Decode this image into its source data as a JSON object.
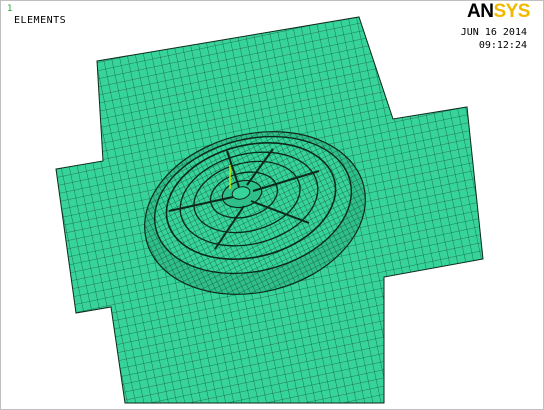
{
  "window": {
    "plot_number": "1",
    "title": "ELEMENTS",
    "date": "JUN 16 2014",
    "time": "09:12:24"
  },
  "logo": {
    "part1": "AN",
    "part2": "SYS"
  },
  "colors": {
    "mesh_fill": "#36d39a",
    "mesh_line": "#0c2a1c",
    "logo_accent": "#f2b800",
    "background": "#ffffff"
  }
}
